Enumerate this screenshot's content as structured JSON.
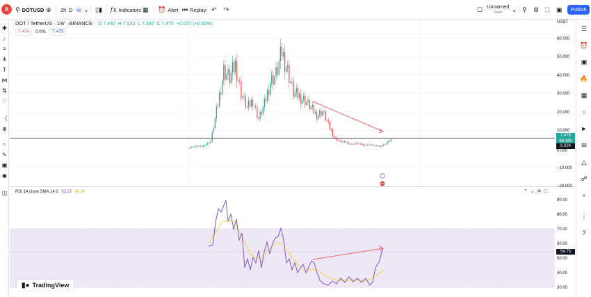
{
  "toolbar": {
    "avatar_letter": "A",
    "symbol": "DOTUSD",
    "interval": "2h",
    "range_d": "D",
    "range_w": "W",
    "indicators_label": "Indicators",
    "alert_label": "Alert",
    "replay_label": "Replay",
    "layout_name": "Unnamed",
    "layout_status": "Save",
    "publish_label": "Publish"
  },
  "legend": {
    "title": "DOT / TetherUS · 1W · BINANCE",
    "o": "O 7.440",
    "h": "H 7.533",
    "l": "L 7.350",
    "c": "C 7.475",
    "chg": "+0.037 (+0.50%)",
    "bid": "7.474",
    "spread": "0.001",
    "ask": "7.475"
  },
  "price_axis": {
    "currency": "USDT",
    "ticks": [
      "60.000",
      "50.000",
      "40.000",
      "30.000",
      "20.000",
      "10.000",
      "0.000",
      "−10.000",
      "−20.000"
    ],
    "last_price": "7.475",
    "countdown": "6d 18h",
    "level": "6.024"
  },
  "rsi": {
    "legend": "RSI 14 close SMA 14 2",
    "val1": "53.27",
    "val2": "48.34",
    "ticks": [
      "90.00",
      "80.00",
      "70.00",
      "60.00",
      "50.00",
      "40.00",
      "30.00"
    ],
    "last": "54.75"
  },
  "logo": {
    "text": "TradingView"
  },
  "colors": {
    "up": "#26a69a",
    "down": "#ef5350",
    "rsi_line": "#7e57c2",
    "rsi_ma": "#f5d53a",
    "band": "#ede7f6",
    "accent": "#2962ff"
  }
}
